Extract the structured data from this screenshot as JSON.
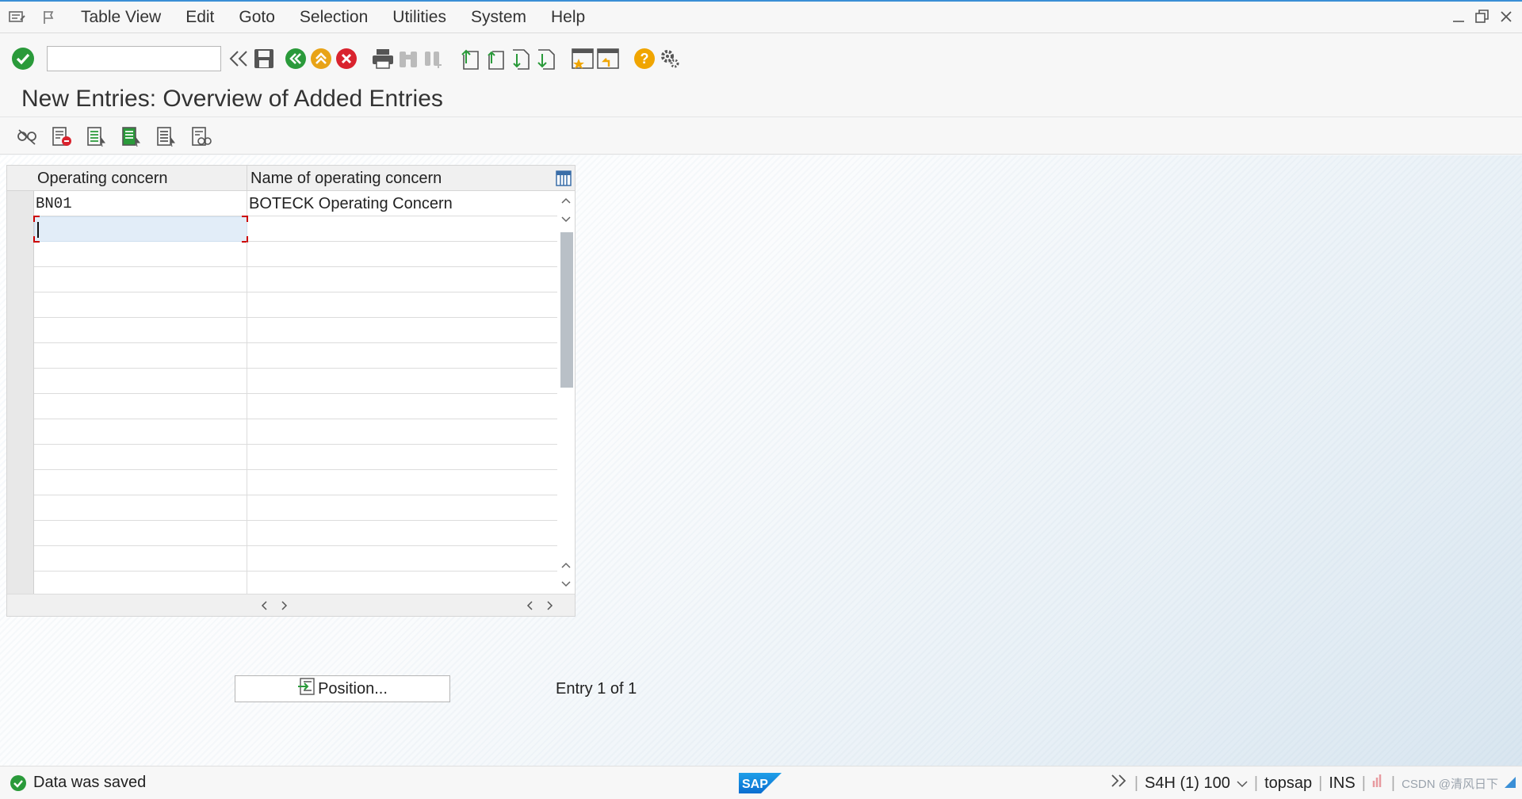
{
  "menu": {
    "items": [
      {
        "label": "Table View"
      },
      {
        "label": "Edit"
      },
      {
        "label": "Goto"
      },
      {
        "label": "Selection"
      },
      {
        "label": "Utilities"
      },
      {
        "label": "System"
      },
      {
        "label": "Help"
      }
    ]
  },
  "toolbar": {
    "command_value": "",
    "icons": [
      "enter-icon",
      "back-icon",
      "save-icon",
      "back-green-icon",
      "exit-icon",
      "cancel-icon",
      "print-icon",
      "find-icon",
      "find-next-icon",
      "first-page-icon",
      "previous-page-icon",
      "next-page-icon",
      "last-page-icon",
      "create-session-icon",
      "shortcut-icon",
      "help-icon",
      "customize-icon"
    ]
  },
  "page": {
    "title": "New Entries: Overview of Added Entries"
  },
  "app_toolbar": {
    "icons": [
      "change-display-icon",
      "delete-icon",
      "select-all-icon",
      "select-block-icon",
      "deselect-all-icon",
      "details-icon"
    ]
  },
  "table": {
    "columns": [
      "Operating concern",
      "Name of operating concern"
    ],
    "rows": [
      {
        "operating_concern": "BN01",
        "name": "BOTECK Operating Concern"
      }
    ],
    "empty_rows": 15
  },
  "position_button": {
    "label": "Position..."
  },
  "entry_info": "Entry 1 of 1",
  "status": {
    "message": "Data was saved",
    "system": "S4H (1) 100",
    "server": "topsap",
    "mode": "INS",
    "watermark": "CSDN @清风日下"
  },
  "colors": {
    "success": "#2a9a3a",
    "accent": "#3a8fd6",
    "exit": "#e8a317",
    "cancel": "#d9232e",
    "help": "#f0a500"
  }
}
